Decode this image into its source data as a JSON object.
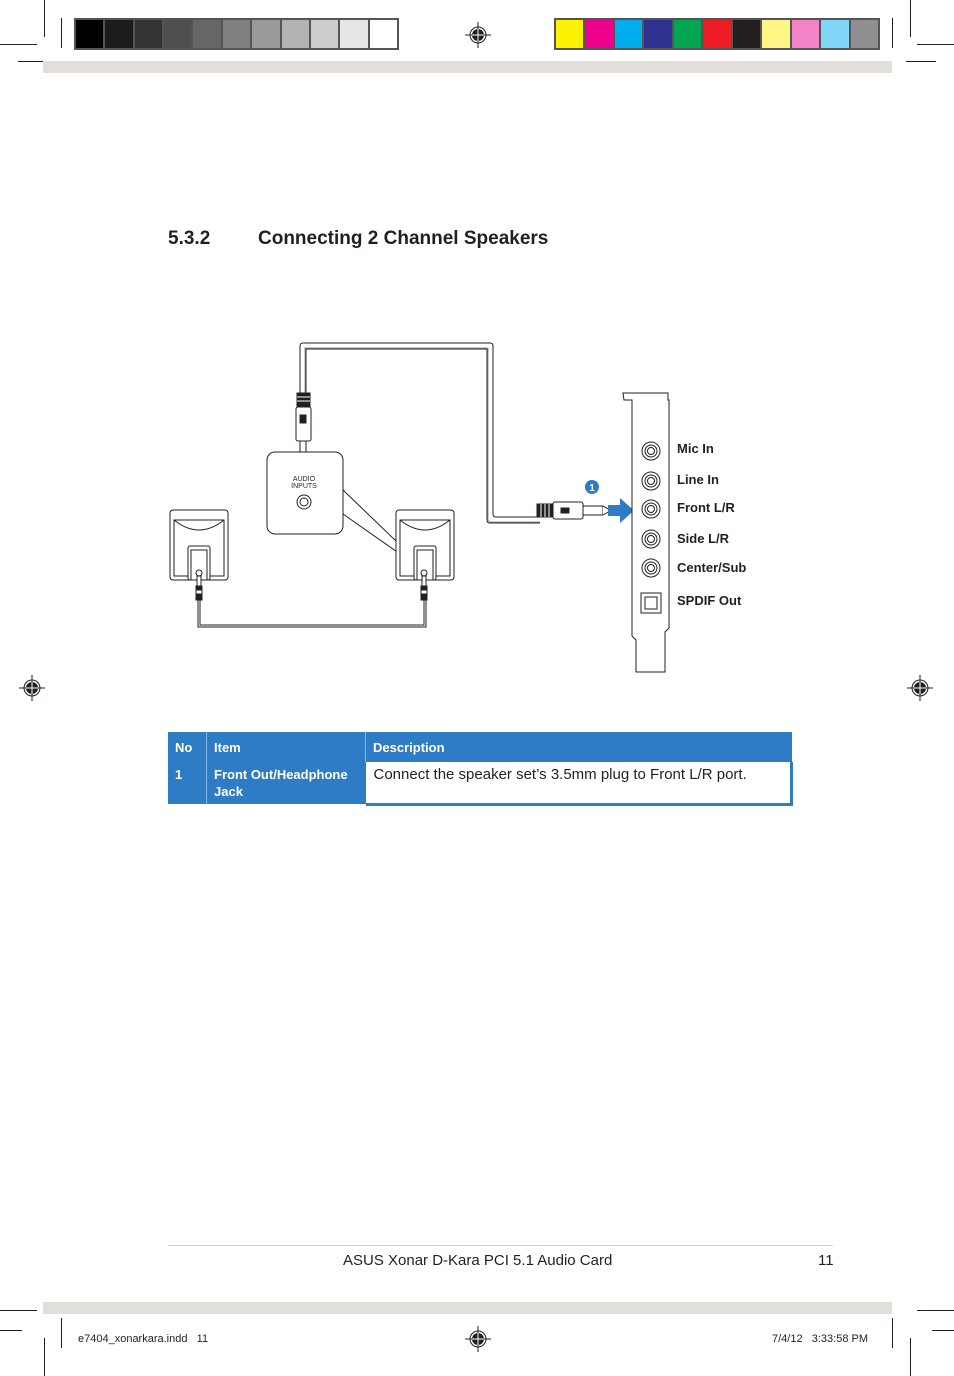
{
  "print_marks": {
    "grayscale_swatches": [
      "#000000",
      "#1c1c1c",
      "#333333",
      "#4f4f4f",
      "#666666",
      "#7f7f7f",
      "#999999",
      "#b2b2b2",
      "#cccccc",
      "#e5e5e5",
      "#ffffff"
    ],
    "color_swatches": [
      "#fff200",
      "#ec008c",
      "#00aeef",
      "#2e3192",
      "#00a651",
      "#ed1c24",
      "#231f20",
      "#fff685",
      "#f383c6",
      "#7fd6f7",
      "#8f8f8f"
    ]
  },
  "section": {
    "number": "5.3.2",
    "title": "Connecting 2 Channel Speakers"
  },
  "diagram": {
    "speaker_panel_label_line1": "AUDIO",
    "speaker_panel_label_line2": "INPUTS",
    "callout_number": "1",
    "accent_color": "#2e7cc6",
    "ports": [
      {
        "label": "Mic In"
      },
      {
        "label": "Line In"
      },
      {
        "label": "Front L/R"
      },
      {
        "label": "Side L/R"
      },
      {
        "label": "Center/Sub"
      },
      {
        "label": "SPDIF Out"
      }
    ]
  },
  "table": {
    "headers": [
      "No",
      "Item",
      "Description"
    ],
    "rows": [
      {
        "no": "1",
        "item": "Front Out/Headphone Jack",
        "description": "Connect the speaker set’s 3.5mm plug to Front L/R port."
      }
    ]
  },
  "footer": {
    "title": "ASUS Xonar D-Kara PCI 5.1 Audio Card",
    "page": "11"
  },
  "slug": {
    "file": "e7404_xonarkara.indd   11",
    "timestamp": "7/4/12   3:33:58 PM"
  }
}
